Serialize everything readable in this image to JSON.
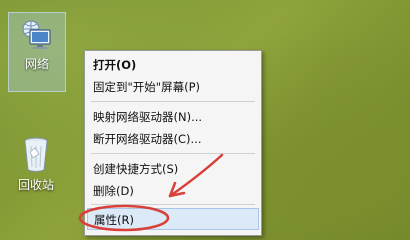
{
  "desktop": {
    "icons": [
      {
        "label": "网络",
        "icon": "network-computer-icon",
        "selected": true
      },
      {
        "label": "回收站",
        "icon": "recycle-bin-icon",
        "selected": false
      }
    ]
  },
  "context_menu": {
    "items": [
      {
        "label": "打开(O)",
        "bold": true
      },
      {
        "label": "固定到\"开始\"屏幕(P)"
      },
      {
        "label": "映射网络驱动器(N)..."
      },
      {
        "label": "断开网络驱动器(C)..."
      },
      {
        "label": "创建快捷方式(S)"
      },
      {
        "label": "删除(D)"
      },
      {
        "label": "属性(R)",
        "highlighted": true
      }
    ]
  },
  "annotation": {
    "color": "#d8403a",
    "shape": "ellipse-with-arrow"
  }
}
